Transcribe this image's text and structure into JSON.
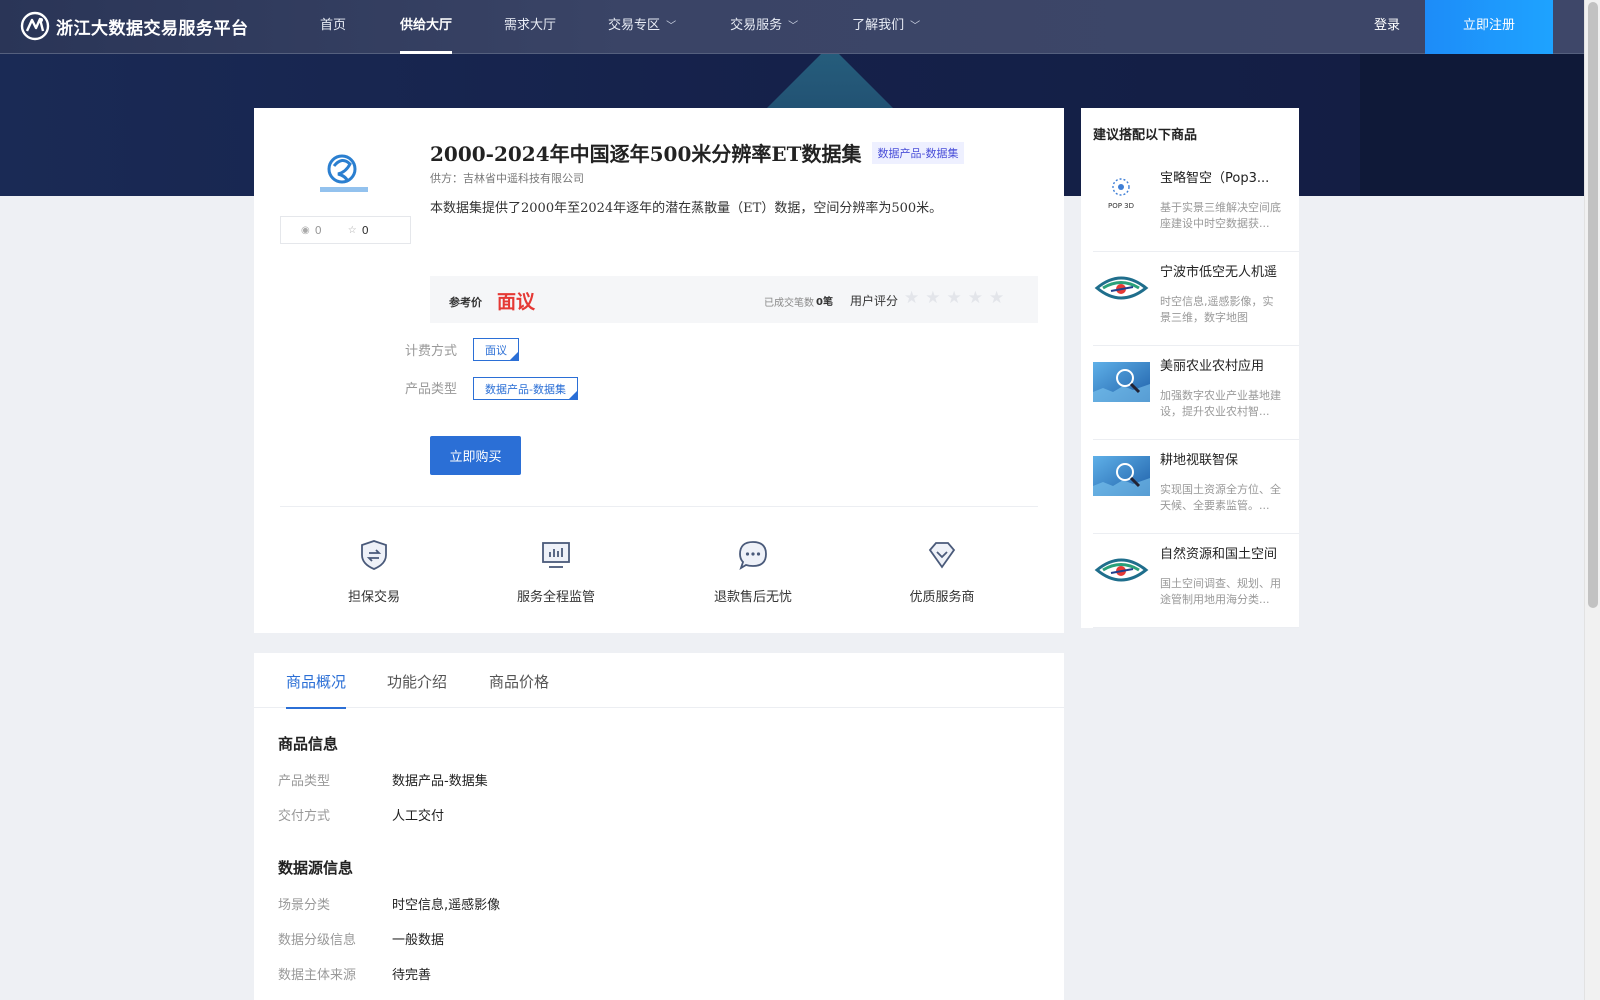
{
  "header": {
    "logo_text": "浙江大数据交易服务平台",
    "nav": [
      {
        "label": "首页",
        "has_chevron": false,
        "active": false
      },
      {
        "label": "供给大厅",
        "has_chevron": false,
        "active": true
      },
      {
        "label": "需求大厅",
        "has_chevron": false,
        "active": false
      },
      {
        "label": "交易专区",
        "has_chevron": true,
        "active": false
      },
      {
        "label": "交易服务",
        "has_chevron": true,
        "active": false
      },
      {
        "label": "了解我们",
        "has_chevron": true,
        "active": false
      }
    ],
    "login_label": "登录",
    "register_label": "立即注册"
  },
  "product": {
    "title": "2000-2024年中国逐年500米分辨率ET数据集",
    "category_tag": "数据产品-数据集",
    "supplier": "供方：吉林省中遥科技有限公司",
    "description": "本数据集提供了2000年至2024年逐年的潜在蒸散量（ET）数据，空间分辨率为500米。",
    "views": "0",
    "favorites": "0",
    "price_label": "参考价",
    "price_value": "面议",
    "deals_label": "已成交笔数",
    "deals_value": "0笔",
    "rating_label": "用户评分",
    "rating_stars": "★★★★★",
    "billing_label": "计费方式",
    "billing_value": "面议",
    "type_label": "产品类型",
    "type_value": "数据产品-数据集",
    "buy_label": "立即购买",
    "features": [
      {
        "label": "担保交易",
        "icon": "shield-exchange-icon"
      },
      {
        "label": "服务全程监管",
        "icon": "monitor-chart-icon"
      },
      {
        "label": "退款售后无忧",
        "icon": "chat-bubble-icon"
      },
      {
        "label": "优质服务商",
        "icon": "diamond-icon"
      }
    ]
  },
  "recommend": {
    "title": "建议搭配以下商品",
    "items": [
      {
        "name": "宝略智空（Pop3...",
        "desc": "基于实景三维解决空间底座建设中时空数据获...",
        "thumb_text": "POP 3D"
      },
      {
        "name": "宁波市低空无人机遥",
        "desc": "时空信息,遥感影像，实景三维，数字地图"
      },
      {
        "name": "美丽农业农村应用",
        "desc": "加强数字农业产业基地建设，提升农业农村智..."
      },
      {
        "name": "耕地视联智保",
        "desc": "实现国土资源全方位、全天候、全要素监管。..."
      },
      {
        "name": "自然资源和国土空间",
        "desc": "国土空间调查、规划、用途管制用地用海分类..."
      }
    ]
  },
  "detail": {
    "tabs": [
      "商品概况",
      "功能介绍",
      "商品价格"
    ],
    "section1_title": "商品信息",
    "section1_rows": [
      {
        "k": "产品类型",
        "v": "数据产品-数据集"
      },
      {
        "k": "交付方式",
        "v": "人工交付"
      }
    ],
    "section2_title": "数据源信息",
    "section2_rows": [
      {
        "k": "场景分类",
        "v": "时空信息,遥感影像"
      },
      {
        "k": "数据分级信息",
        "v": "一般数据"
      },
      {
        "k": "数据主体来源",
        "v": "待完善"
      }
    ]
  },
  "colors": {
    "accent": "#2b6fd6",
    "price": "#e53935",
    "header_bg": "#3a4466"
  }
}
